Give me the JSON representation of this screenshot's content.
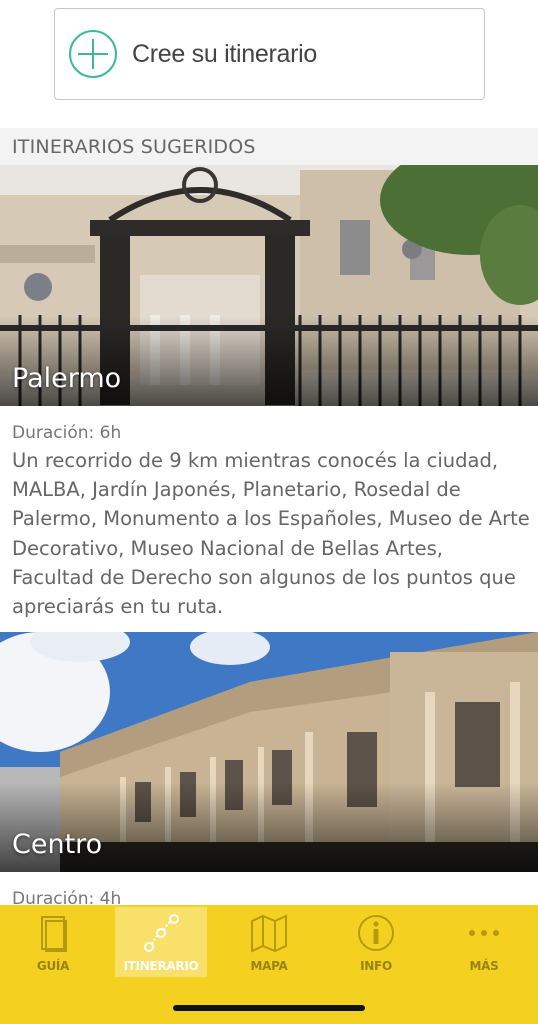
{
  "create_button": {
    "label": "Cree su itinerario",
    "icon": "plus-circle-icon",
    "accent": "#3db89a"
  },
  "section": {
    "title": "ITINERARIOS SUGERIDOS"
  },
  "itineraries": [
    {
      "title": "Palermo",
      "duration": "Duración: 6h",
      "description": "Un recorrido de 9 km mientras conocés la ciudad, MALBA, Jardín Japonés, Planetario, Rosedal de Palermo, Monumento a los Españoles, Museo de Arte Decorativo, Museo Nacional de Bellas Artes, Facultad de Derecho son algunos de los puntos que apreciarás en tu ruta."
    },
    {
      "title": "Centro",
      "duration": "Duración: 4h"
    }
  ],
  "tabbar": {
    "background": "#f4d120",
    "tabs": [
      {
        "label": "GUÍA",
        "icon": "book-icon",
        "active": false
      },
      {
        "label": "ITINERARIO",
        "icon": "route-icon",
        "active": true
      },
      {
        "label": "MAPA",
        "icon": "map-icon",
        "active": false
      },
      {
        "label": "INFO",
        "icon": "info-icon",
        "active": false
      },
      {
        "label": "MÁS",
        "icon": "more-dots-icon",
        "active": false
      }
    ]
  }
}
